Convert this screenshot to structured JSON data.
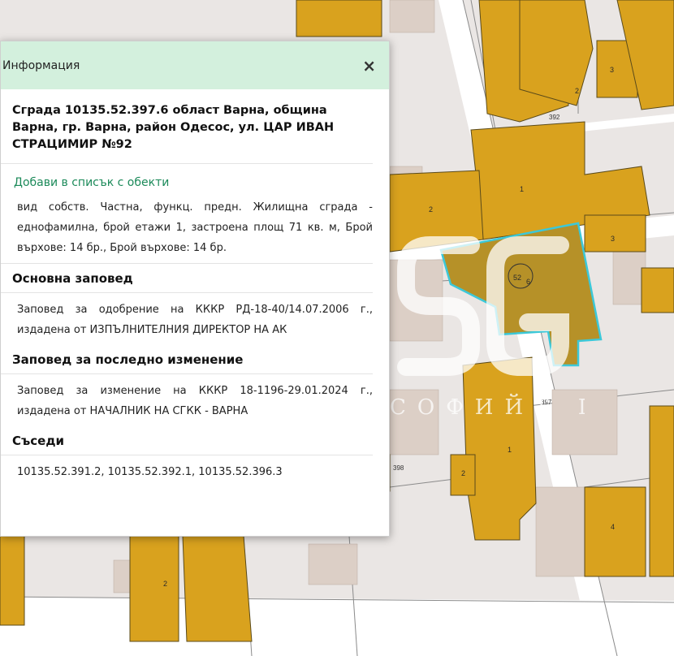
{
  "map": {
    "parcel_numbers": [
      "3",
      "2",
      "392",
      "2",
      "1",
      "3",
      "2",
      "397",
      "1",
      "2",
      "398",
      "4",
      "2"
    ],
    "selected_building_label": "52",
    "selected_building_sub": "6",
    "colors": {
      "background": "#eae6e4",
      "building": "#d9a21e",
      "building_stroke": "#5a4a1a",
      "highlight": "#3cc8d8",
      "roads": "#ffffff"
    }
  },
  "watermark": {
    "text": "СОФИЙТ ГРУП",
    "logo": "SG-logo"
  },
  "panel": {
    "header_title": "Информация",
    "close_label": "×",
    "building_title": "Сграда 10135.52.397.6 област Варна, община Варна, гр. Варна, район Одесос, ул. ЦАР ИВАН СТРАЦИМИР №92",
    "add_to_list": "Добави в списък с обекти",
    "description": "вид собств. Частна, функц. предн. Жилищна сграда - еднофамилна, брой етажи 1, застроена площ 71 кв. м, Брой върхове: 14 бр., Брой върхове: 14 бр.",
    "main_order_title": "Основна заповед",
    "main_order_text": "Заповед за одобрение на КККР РД-18-40/14.07.2006 г., издадена от ИЗПЪЛНИТЕЛНИЯ ДИРЕКТОР НА АК",
    "last_change_title": "Заповед за последно изменение",
    "last_change_text": "Заповед за изменение на КККР 18-1196-29.01.2024 г., издадена от НАЧАЛНИК НА СГКК - ВАРНА",
    "neighbours_title": "Съседи",
    "neighbours_text": "10135.52.391.2, 10135.52.392.1, 10135.52.396.3"
  }
}
